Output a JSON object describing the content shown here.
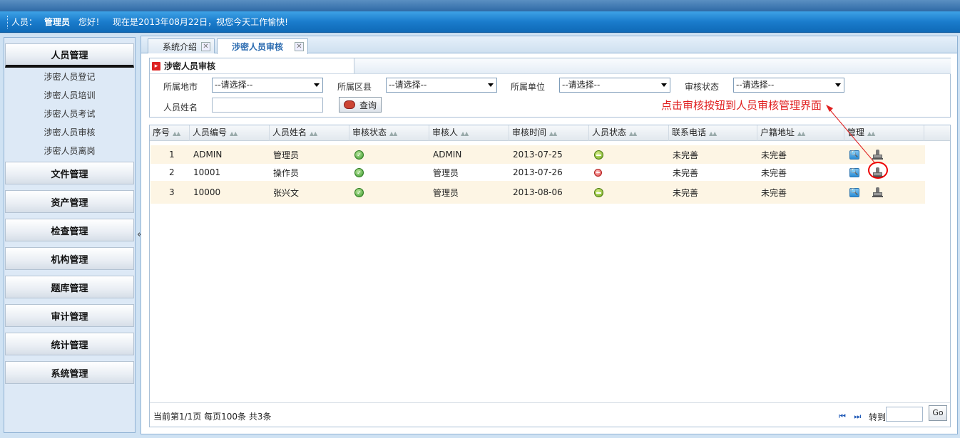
{
  "header": {
    "user_label": "人员：",
    "user_name": "管理员",
    "greeting": "您好！",
    "date_message": "现在是2013年08月22日，视您今天工作愉快!"
  },
  "sidebar": {
    "groups": [
      {
        "label": "人员管理",
        "active": true,
        "items": [
          "涉密人员登记",
          "涉密人员培训",
          "涉密人员考试",
          "涉密人员审核",
          "涉密人员离岗"
        ]
      },
      {
        "label": "文件管理"
      },
      {
        "label": "资产管理"
      },
      {
        "label": "检查管理"
      },
      {
        "label": "机构管理"
      },
      {
        "label": "题库管理"
      },
      {
        "label": "审计管理"
      },
      {
        "label": "统计管理"
      },
      {
        "label": "系统管理"
      }
    ],
    "collapse_glyph": "«"
  },
  "tabs": [
    {
      "label": "系统介绍",
      "active": false
    },
    {
      "label": "涉密人员审核",
      "active": true
    }
  ],
  "search_panel": {
    "title": "涉密人员审核",
    "fields": {
      "city_label": "所属地市",
      "city_value": "--请选择--",
      "district_label": "所属区县",
      "district_value": "--请选择--",
      "unit_label": "所属单位",
      "unit_value": "--请选择--",
      "status_label": "审核状态",
      "status_value": "--请选择--",
      "name_label": "人员姓名",
      "name_value": ""
    },
    "query_button": "查询"
  },
  "annotation": {
    "text": "点击审核按钮到人员审核管理界面",
    "color": "#e02020"
  },
  "table": {
    "columns": [
      "序号",
      "人员编号",
      "人员姓名",
      "审核状态",
      "审核人",
      "审核时间",
      "人员状态",
      "联系电话",
      "户籍地址",
      "管理"
    ],
    "rows": [
      {
        "no": "1",
        "id": "ADMIN",
        "name": "管理员",
        "audit_status": "approved",
        "auditor": "ADMIN",
        "audit_time": "2013-07-25",
        "person_status": "green",
        "phone": "未完善",
        "address": "未完善"
      },
      {
        "no": "2",
        "id": "10001",
        "name": "操作员",
        "audit_status": "approved",
        "auditor": "管理员",
        "audit_time": "2013-07-26",
        "person_status": "red",
        "phone": "未完善",
        "address": "未完善"
      },
      {
        "no": "3",
        "id": "10000",
        "name": "张兴文",
        "audit_status": "approved",
        "auditor": "管理员",
        "audit_time": "2013-08-06",
        "person_status": "green",
        "phone": "未完善",
        "address": "未完善"
      }
    ]
  },
  "pager": {
    "info": "当前第1/1页  每页100条  共3条",
    "nav_glyphs": "⏮ ⏭",
    "goto_label": "转到",
    "goto_value": "",
    "go_button": "Go"
  },
  "colors": {
    "header_blue": "#1a7ccc",
    "row_alt": "#fdf5e4",
    "active_tab_text": "#2b6bb0"
  },
  "icons": [
    "view-icon",
    "audit-stamp-icon",
    "approved-check-icon",
    "status-green-icon",
    "status-red-icon",
    "close-tab-icon",
    "search-magnifier-icon",
    "first-page-icon",
    "last-page-icon"
  ]
}
